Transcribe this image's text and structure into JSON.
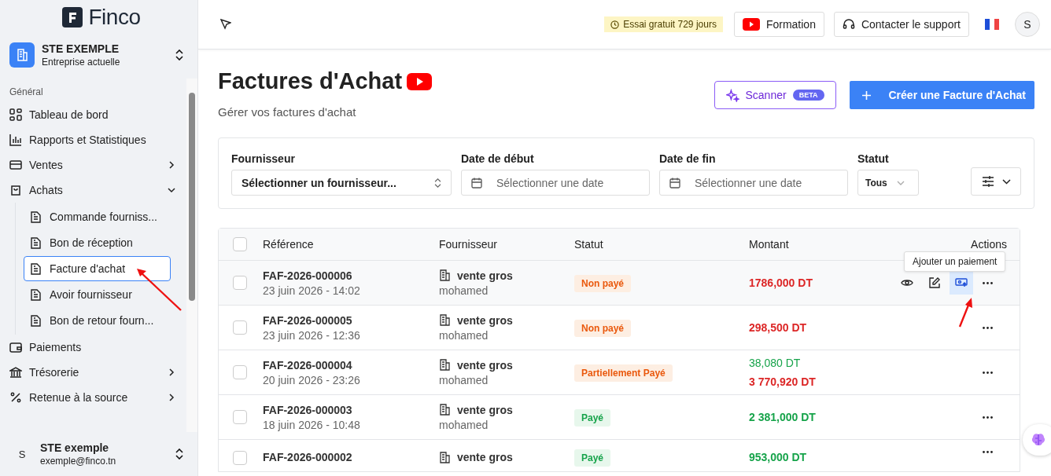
{
  "sidebar": {
    "logo": "Finco",
    "company": {
      "name": "STE EXEMPLE",
      "subtitle": "Entreprise actuelle"
    },
    "section_label": "Général",
    "items": [
      {
        "kind": "link",
        "label": "Tableau de bord"
      },
      {
        "kind": "link",
        "label": "Rapports et Statistiques"
      },
      {
        "kind": "group",
        "label": "Ventes",
        "expanded": false
      },
      {
        "kind": "group",
        "label": "Achats",
        "expanded": true,
        "children": [
          {
            "label": "Commande fourniss...",
            "selected": false
          },
          {
            "label": "Bon de réception",
            "selected": false
          },
          {
            "label": "Facture d'achat",
            "selected": true
          },
          {
            "label": "Avoir fournisseur",
            "selected": false
          },
          {
            "label": "Bon de retour fourn...",
            "selected": false
          }
        ]
      },
      {
        "kind": "link",
        "label": "Paiements"
      },
      {
        "kind": "group",
        "label": "Trésorerie",
        "expanded": false
      },
      {
        "kind": "group",
        "label": "Retenue à la source",
        "expanded": false
      }
    ],
    "user": {
      "initial": "S",
      "name": "STE exemple",
      "email": "exemple@finco.tn"
    }
  },
  "header": {
    "trial": "Essai gratuit 729 jours",
    "formation": "Formation",
    "support": "Contacter le support",
    "avatar": "S"
  },
  "page": {
    "title": "Factures d'Achat",
    "subtitle": "Gérer vos factures d'achat",
    "scanner": "Scanner",
    "scanner_badge": "BETA",
    "create": "Créer une Facture d'Achat"
  },
  "filters": [
    {
      "kind": "select",
      "label": "Fournisseur",
      "value": "Sélectionner un fournisseur..."
    },
    {
      "kind": "date",
      "label": "Date de début",
      "placeholder": "Sélectionner une date"
    },
    {
      "kind": "date",
      "label": "Date de fin",
      "placeholder": "Sélectionner une date"
    },
    {
      "kind": "status",
      "label": "Statut",
      "value": "Tous"
    }
  ],
  "table": {
    "columns": [
      "Référence",
      "Fournisseur",
      "Statut",
      "Montant",
      "Actions"
    ],
    "tooltip": "Ajouter un paiement",
    "select_all_checked": false,
    "rows": [
      {
        "reference": "FAF-2026-000006",
        "date": "23 juin 2026 - 14:02",
        "supplier": "vente gros",
        "contact": "mohamed",
        "status": {
          "kind": "unpaid",
          "label": "Non payé"
        },
        "amounts": [
          {
            "kind": "due",
            "text": "1786,000 DT"
          }
        ],
        "hovered": true,
        "checked": false
      },
      {
        "reference": "FAF-2026-000005",
        "date": "23 juin 2026 - 12:36",
        "supplier": "vente gros",
        "contact": "mohamed",
        "status": {
          "kind": "unpaid",
          "label": "Non payé"
        },
        "amounts": [
          {
            "kind": "due",
            "text": "298,500 DT"
          }
        ],
        "hovered": false,
        "checked": false
      },
      {
        "reference": "FAF-2026-000004",
        "date": "20 juin 2026 - 23:26",
        "supplier": "vente gros",
        "contact": "mohamed",
        "status": {
          "kind": "partial",
          "label": "Partiellement Payé"
        },
        "amounts": [
          {
            "kind": "paid_part",
            "text": "38,080 DT"
          },
          {
            "kind": "due",
            "text": "3 770,920 DT"
          }
        ],
        "hovered": false,
        "checked": false
      },
      {
        "reference": "FAF-2026-000003",
        "date": "18 juin 2026 - 10:48",
        "supplier": "vente gros",
        "contact": "mohamed",
        "status": {
          "kind": "paid",
          "label": "Payé"
        },
        "amounts": [
          {
            "kind": "paid",
            "text": "2 381,000 DT"
          }
        ],
        "hovered": false,
        "checked": false
      },
      {
        "reference": "FAF-2026-000002",
        "supplier": "vente gros",
        "status": {
          "kind": "paid",
          "label": "Payé"
        },
        "amounts": [
          {
            "kind": "paid",
            "text": "953,000 DT"
          }
        ],
        "hovered": false,
        "checked": false
      }
    ]
  }
}
